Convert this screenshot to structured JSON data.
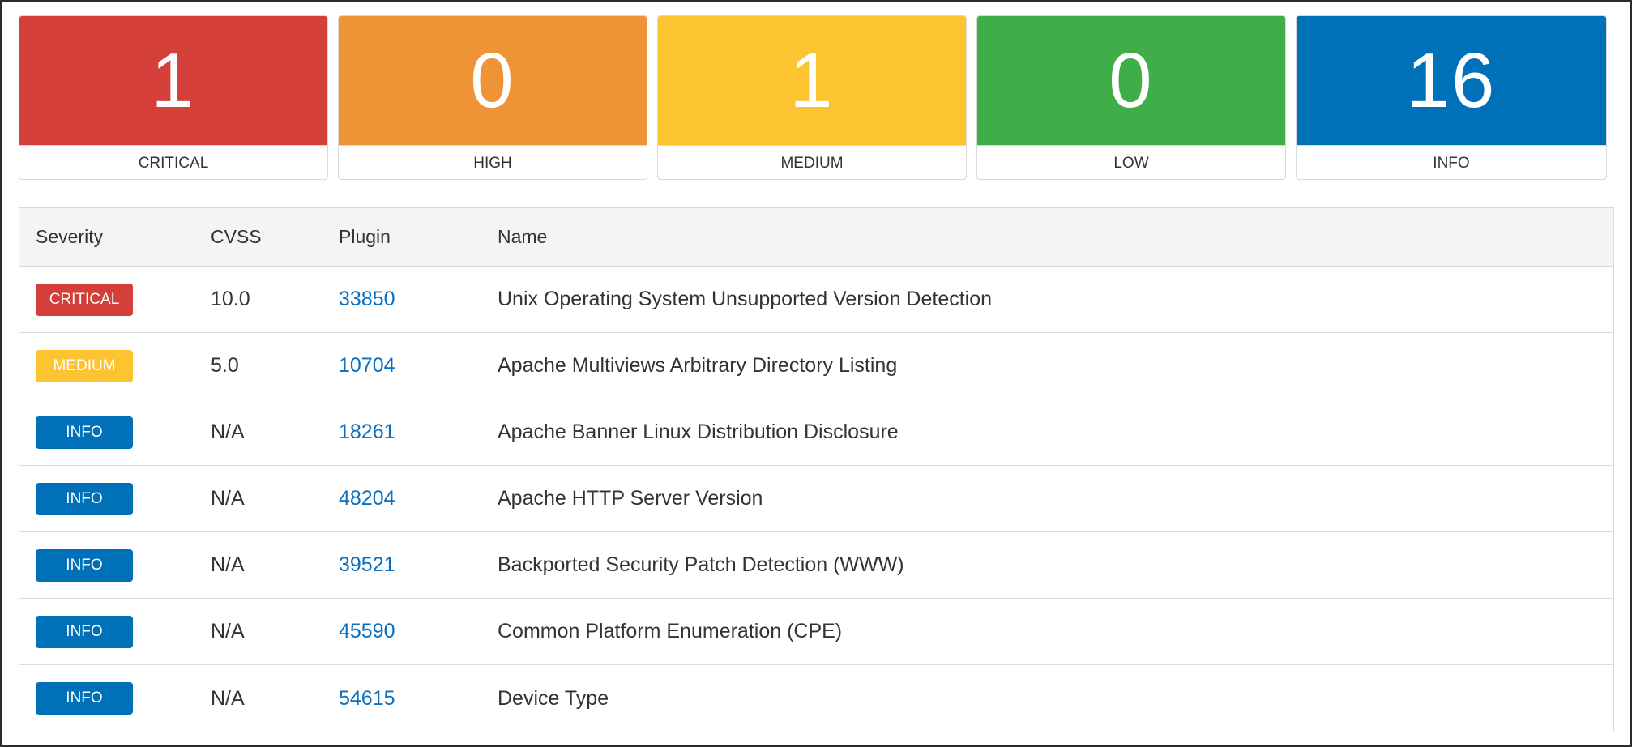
{
  "summary": [
    {
      "count": "1",
      "label": "CRITICAL",
      "color": "#d43f3a"
    },
    {
      "count": "0",
      "label": "HIGH",
      "color": "#ee9336"
    },
    {
      "count": "1",
      "label": "MEDIUM",
      "color": "#fdc431"
    },
    {
      "count": "0",
      "label": "LOW",
      "color": "#3fae49"
    },
    {
      "count": "16",
      "label": "INFO",
      "color": "#0071b9"
    }
  ],
  "table": {
    "headers": {
      "severity": "Severity",
      "cvss": "CVSS",
      "plugin": "Plugin",
      "name": "Name"
    },
    "rows": [
      {
        "severity": "CRITICAL",
        "severity_color": "#d43f3a",
        "cvss": "10.0",
        "plugin": "33850",
        "name": "Unix Operating System Unsupported Version Detection"
      },
      {
        "severity": "MEDIUM",
        "severity_color": "#fdc431",
        "cvss": "5.0",
        "plugin": "10704",
        "name": "Apache Multiviews Arbitrary Directory Listing"
      },
      {
        "severity": "INFO",
        "severity_color": "#0071b9",
        "cvss": "N/A",
        "plugin": "18261",
        "name": "Apache Banner Linux Distribution Disclosure"
      },
      {
        "severity": "INFO",
        "severity_color": "#0071b9",
        "cvss": "N/A",
        "plugin": "48204",
        "name": "Apache HTTP Server Version"
      },
      {
        "severity": "INFO",
        "severity_color": "#0071b9",
        "cvss": "N/A",
        "plugin": "39521",
        "name": "Backported Security Patch Detection (WWW)"
      },
      {
        "severity": "INFO",
        "severity_color": "#0071b9",
        "cvss": "N/A",
        "plugin": "45590",
        "name": "Common Platform Enumeration (CPE)"
      },
      {
        "severity": "INFO",
        "severity_color": "#0071b9",
        "cvss": "N/A",
        "plugin": "54615",
        "name": "Device Type"
      }
    ]
  }
}
